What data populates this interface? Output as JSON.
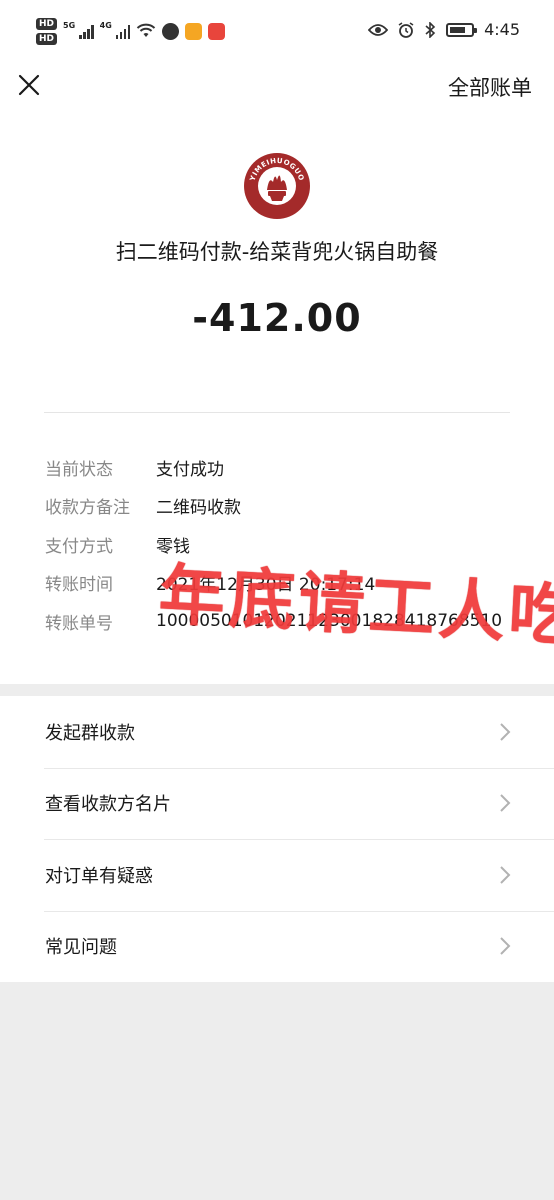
{
  "status_bar": {
    "hd1": "HD",
    "hd2": "HD",
    "gen1": "5G",
    "gen2": "4G",
    "time": "4:45",
    "icons": [
      "hd-icon",
      "signal-icon",
      "wifi-icon",
      "app-icon",
      "eye-icon",
      "alarm-icon",
      "bluetooth-icon",
      "battery-icon"
    ]
  },
  "nav": {
    "close_icon": "close-icon",
    "all_bills_label": "全部账单"
  },
  "merchant": {
    "logo_text": "YIMEIHUOGUO",
    "name": "扫二维码付款-给菜背兜火锅自助餐",
    "amount": "-412.00"
  },
  "details": [
    {
      "label": "当前状态",
      "value": "支付成功"
    },
    {
      "label": "收款方备注",
      "value": "二维码收款"
    },
    {
      "label": "支付方式",
      "value": "零钱"
    },
    {
      "label": "转账时间",
      "value": "2021年12月30日 20:17:14"
    },
    {
      "label": "转账单号",
      "value": "10000501012021123001828418768510"
    }
  ],
  "overlay": {
    "text": "年底请工人吃饭",
    "color": "#f03a3a"
  },
  "menu": [
    {
      "label": "发起群收款"
    },
    {
      "label": "查看收款方名片"
    },
    {
      "label": "对订单有疑惑"
    },
    {
      "label": "常见问题"
    }
  ],
  "colors": {
    "background": "#ededed",
    "card": "#ffffff",
    "logo_red": "#a42a2a",
    "label_gray": "#888888"
  }
}
